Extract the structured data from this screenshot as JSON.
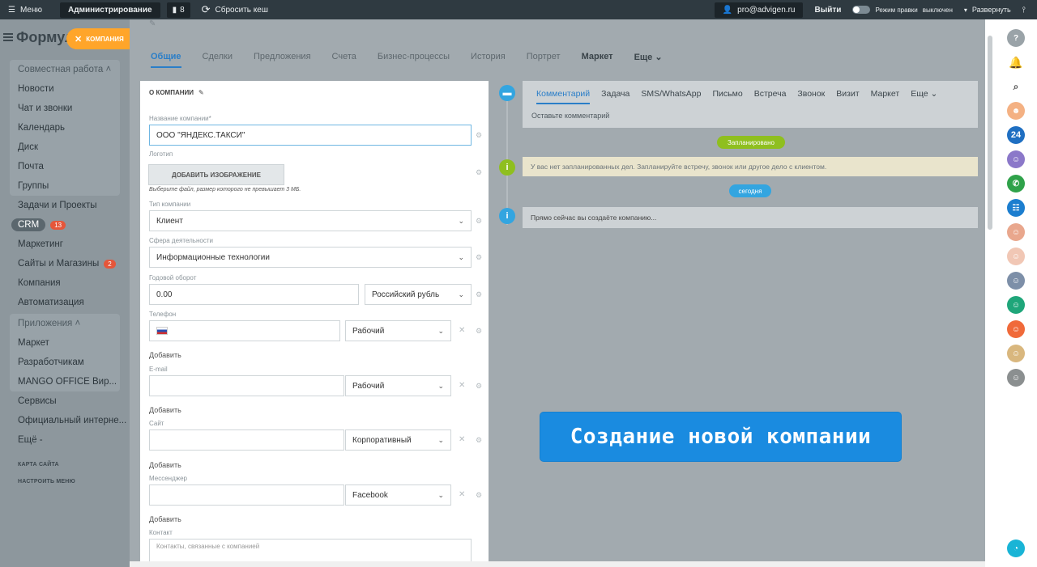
{
  "topbar": {
    "menu_label": "Меню",
    "admin_label": "Администрирование",
    "counter": "8",
    "reset_label": "Сбросить кеш",
    "email": "pro@advigen.ru",
    "logout": "Выйти",
    "rights_label": "Режим правки",
    "rights_state": "выключен",
    "expand": "Развернуть"
  },
  "sidebar": {
    "logo": "Формул",
    "group1_head": "Совместная работа",
    "group1": [
      "Новости",
      "Чат и звонки",
      "Календарь",
      "Диск",
      "Почта",
      "Группы"
    ],
    "tasks": "Задачи и Проекты",
    "crm": "CRM",
    "crm_badge": "13",
    "marketing": "Маркетинг",
    "sites": "Сайты и Магазины",
    "sites_badge": "2",
    "company": "Компания",
    "automation": "Автоматизация",
    "group2_head": "Приложения",
    "group2": [
      "Маркет",
      "Разработчикам",
      "MANGO OFFICE Вир..."
    ],
    "services": "Сервисы",
    "official": "Официальный интерне...",
    "more": "Ещё -",
    "sitemap": "КАРТА САЙТА",
    "setup_menu": "НАСТРОИТЬ МЕНЮ"
  },
  "company_tag": "КОМПАНИЯ",
  "tabs": [
    "Общие",
    "Сделки",
    "Предложения",
    "Счета",
    "Бизнес-процессы",
    "История",
    "Портрет",
    "Маркет",
    "Еще"
  ],
  "form": {
    "title": "О КОМПАНИИ",
    "name_label": "Название компании*",
    "name_value": "ООО \"ЯНДЕКС.ТАКСИ\"",
    "logo_label": "Логотип",
    "add_image": "ДОБАВИТЬ ИЗОБРАЖЕНИЕ",
    "image_hint": "Выберите файл, размер которого не превышает 3 МБ.",
    "type_label": "Тип компании",
    "type_value": "Клиент",
    "sphere_label": "Сфера деятельности",
    "sphere_value": "Информационные технологии",
    "revenue_label": "Годовой оборот",
    "revenue_value": "0.00",
    "currency_value": "Российский рубль",
    "phone_label": "Телефон",
    "phone_type": "Рабочий",
    "add": "Добавить",
    "email_label": "E-mail",
    "email_type": "Рабочий",
    "site_label": "Сайт",
    "site_type": "Корпоративный",
    "messenger_label": "Мессенджер",
    "messenger_type": "Facebook",
    "contact_label": "Контакт",
    "contacts_placeholder": "Контакты, связанные с компанией"
  },
  "timeline": {
    "tabs": [
      "Комментарий",
      "Задача",
      "SMS/WhatsApp",
      "Письмо",
      "Встреча",
      "Звонок",
      "Визит",
      "Маркет",
      "Еще"
    ],
    "comment_placeholder": "Оставьте комментарий",
    "planned": "Запланировано",
    "no_planned": "У вас нет запланированных дел. Запланируйте встречу, звонок или другое дело с клиентом.",
    "today": "сегодня",
    "creating": "Прямо сейчас вы создаёте компанию..."
  },
  "banner": "Создание новой компании",
  "rail": {
    "b24": "24"
  },
  "colors": {
    "accent": "#2a7ec8",
    "orange": "#ffa52a",
    "green_pill": "#8fbf1f",
    "blue_pill": "#33a5e0",
    "banner": "#1a8be0"
  }
}
